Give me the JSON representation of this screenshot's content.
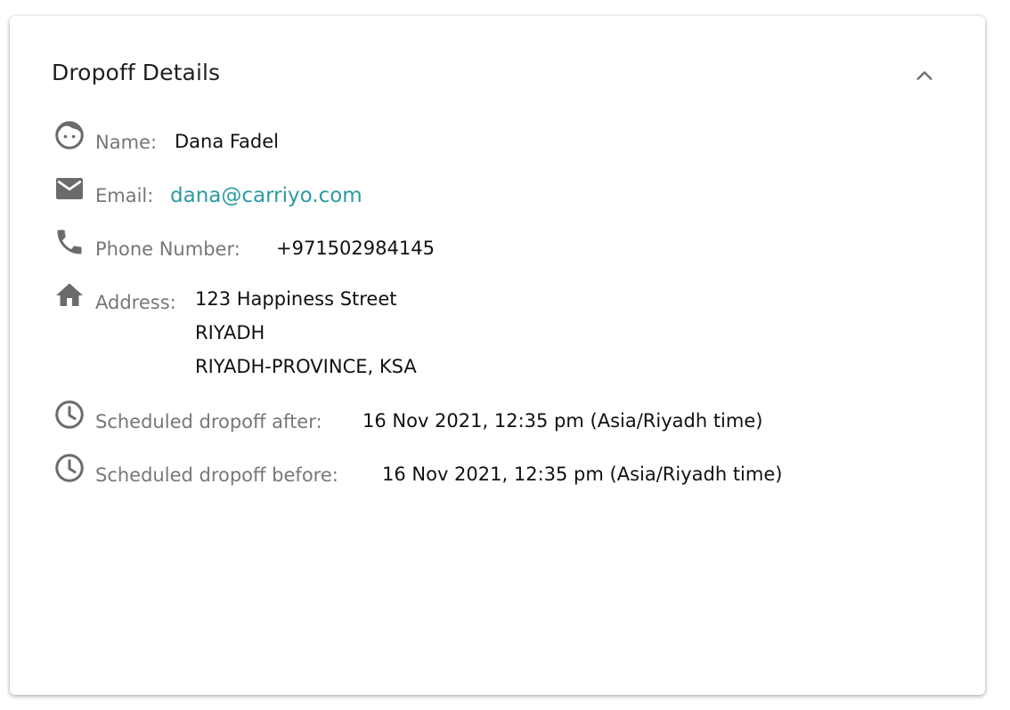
{
  "card": {
    "title": "Dropoff Details"
  },
  "fields": {
    "name": {
      "label": "Name:",
      "value": "Dana Fadel",
      "icon": "face-icon"
    },
    "email": {
      "label": "Email:",
      "value": "dana@carriyo.com",
      "icon": "mail-icon"
    },
    "phone": {
      "label": "Phone Number:",
      "value": "+971502984145",
      "icon": "phone-icon"
    },
    "address": {
      "label": "Address:",
      "lines": [
        "123 Happiness Street",
        "RIYADH",
        "RIYADH-PROVINCE, KSA"
      ],
      "icon": "home-icon"
    },
    "after": {
      "label": "Scheduled dropoff after:",
      "value": "16 Nov 2021, 12:35 pm (Asia/Riyadh time)",
      "icon": "clock-icon"
    },
    "before": {
      "label": "Scheduled dropoff before:",
      "value": "16 Nov 2021, 12:35 pm (Asia/Riyadh time)",
      "icon": "clock-icon"
    }
  },
  "colors": {
    "link": "#2b9aa3",
    "icon": "#6b6b6b",
    "label": "#777777"
  }
}
